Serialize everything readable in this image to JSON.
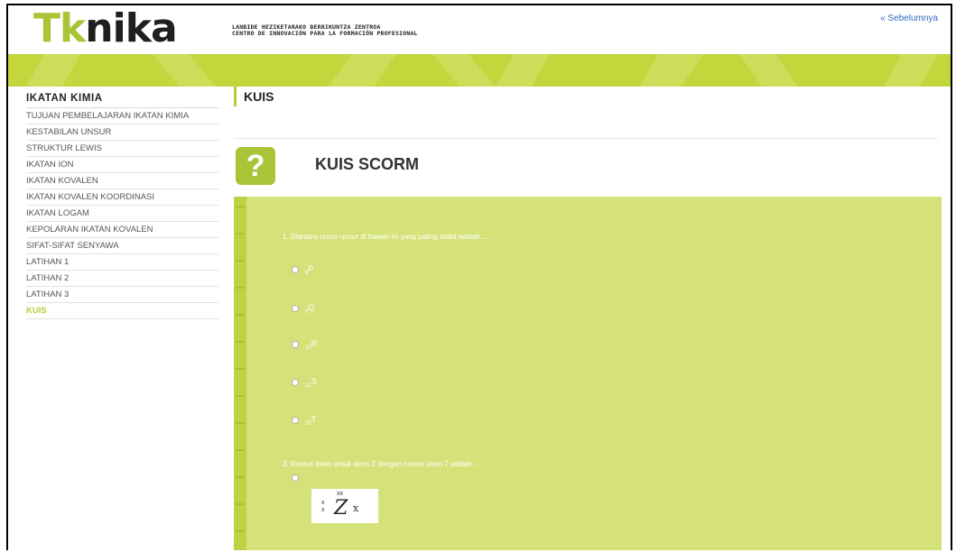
{
  "header": {
    "logo_tk": "Tk",
    "logo_rest": "nika",
    "tagline_line1": "LANBIDE HEZIKETARAKO BERRIKUNTZA ZENTROA",
    "tagline_line2": "CENTRO DE INNOVACIÓN PARA LA FORMACIÓN PROFESIONAL",
    "prev_link": "« Sebelumnya"
  },
  "colors": {
    "accent": "#b7cd3a",
    "quiz_bg": "#d4e279",
    "banner": "#c3d63c"
  },
  "sidebar": {
    "title": "IKATAN KIMIA",
    "items": [
      {
        "label": "TUJUAN PEMBELAJARAN IKATAN KIMIA"
      },
      {
        "label": "KESTABILAN UNSUR"
      },
      {
        "label": "STRUKTUR LEWIS"
      },
      {
        "label": "IKATAN ION"
      },
      {
        "label": "IKATAN KOVALEN"
      },
      {
        "label": "IKATAN KOVALEN KOORDINASI"
      },
      {
        "label": "IKATAN LOGAM"
      },
      {
        "label": "KEPOLARAN IKATAN KOVALEN"
      },
      {
        "label": "SIFAT-SIFAT SENYAWA"
      },
      {
        "label": "LATIHAN 1"
      },
      {
        "label": "LATIHAN 2"
      },
      {
        "label": "LATIHAN 3"
      },
      {
        "label": "KUIS",
        "active": true
      }
    ]
  },
  "main": {
    "page_title": "KUIS",
    "quiz_icon": "question-icon",
    "quiz_icon_glyph": "?",
    "quiz_title": "KUIS SCORM",
    "q1": {
      "text": "1. Diantara unsur-unsur di bawah ini yang paling stabil adalah.....",
      "options": [
        {
          "sub": "8",
          "sym": "P"
        },
        {
          "sub": "9",
          "sym": "Q"
        },
        {
          "sub": "10",
          "sym": "R"
        },
        {
          "sub": "12",
          "sym": "S"
        },
        {
          "sub": "20",
          "sym": "T"
        }
      ]
    },
    "q2": {
      "text": "2. Rumus lewis untuk atom Z dengan nomor atom 7 adalah ...",
      "option1": {
        "dots_left": "x\nx",
        "dots_top": "xx",
        "symbol": "Z",
        "dots_right": "x"
      }
    }
  }
}
